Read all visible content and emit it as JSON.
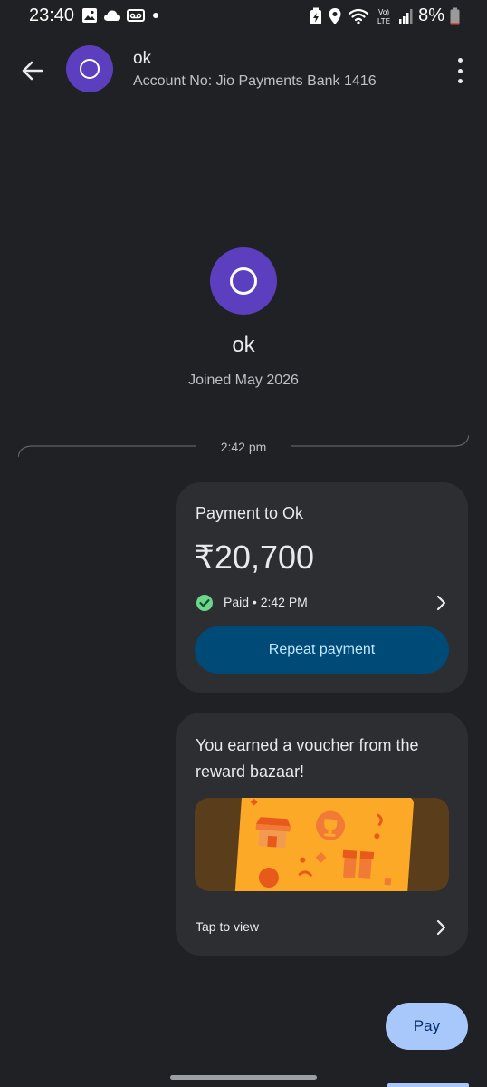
{
  "status_bar": {
    "time": "23:40",
    "battery": "8%",
    "left_icons": [
      "gallery-icon",
      "cloud-icon",
      "voicemail-icon",
      "dot-icon"
    ],
    "right_icons": [
      "battery-saver-icon",
      "location-icon",
      "wifi-icon",
      "volte-icon",
      "signal-icon",
      "battery-icon"
    ]
  },
  "header": {
    "avatar_initial": "O",
    "contact_name": "ok",
    "account_line": "Account No: Jio Payments Bank 1416"
  },
  "profile": {
    "avatar_initial": "O",
    "name": "ok",
    "joined": "Joined May 2026"
  },
  "conversation": {
    "divider_time": "2:42 pm",
    "payment": {
      "title": "Payment to Ok",
      "amount": "₹20,700",
      "status": "Paid • 2:42 PM",
      "repeat_label": "Repeat payment"
    },
    "voucher": {
      "title": "You earned a voucher from the reward bazaar!",
      "tap_label": "Tap to view"
    }
  },
  "fab": {
    "pay_label": "Pay"
  },
  "colors": {
    "background": "#202124",
    "card": "#2d2e31",
    "avatar": "#5b3fbf",
    "repeat_button": "#004a77",
    "pay_button": "#a8c7fa",
    "paid_check": "#6dd58c",
    "voucher_orange": "#fba926"
  }
}
